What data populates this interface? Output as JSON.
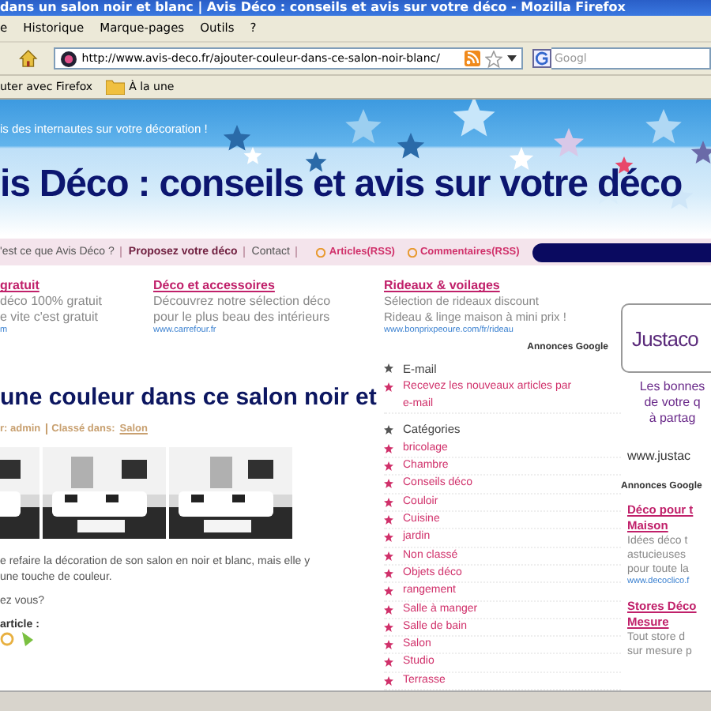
{
  "window": {
    "title": "dans un salon noir et blanc | Avis Déco : conseils et avis sur votre déco - Mozilla Firefox"
  },
  "menu": [
    "e",
    "Historique",
    "Marque-pages",
    "Outils",
    "?"
  ],
  "address": {
    "url": "http://www.avis-deco.fr/ajouter-couleur-dans-ce-salon-noir-blanc/"
  },
  "search": {
    "placeholder": "Googl"
  },
  "bookmarks": [
    {
      "label": "uter avec Firefox",
      "kind": "link"
    },
    {
      "label": "À la une",
      "kind": "folder"
    }
  ],
  "site": {
    "tagline": "is des internautes sur votre décoration !",
    "title": "is Déco : conseils et avis sur votre déco"
  },
  "nav": {
    "links": [
      {
        "label": "'est ce que Avis Déco ?",
        "bold": false
      },
      {
        "label": "Proposez votre déco",
        "bold": true
      },
      {
        "label": "Contact",
        "bold": false
      }
    ],
    "feeds": [
      "Articles(RSS)",
      "Commentaires(RSS)"
    ]
  },
  "ads": [
    {
      "title": "gratuit",
      "lines": [
        "déco 100% gratuit",
        "e vite c'est gratuit"
      ],
      "url": "m"
    },
    {
      "title": "Déco et accessoires",
      "lines": [
        "Découvrez notre sélection déco",
        "pour le plus beau des intérieurs"
      ],
      "url": "www.carrefour.fr"
    },
    {
      "title": "Rideaux & voilages",
      "lines": [
        "Sélection de rideaux discount",
        "Rideau & linge maison à mini prix !"
      ],
      "url": "www.bonprixpeoure.com/fr/rideau"
    }
  ],
  "ads_label": "Annonces Google",
  "post": {
    "title": "une couleur dans ce salon noir et",
    "author": "r: admin",
    "category_label": "Classé dans:",
    "category": "Salon",
    "photos": [
      {
        "kind": "picture"
      },
      {
        "kind": "picture"
      },
      {
        "kind": "picture"
      }
    ],
    "lines": [
      "e refaire la décoration de son salon en noir et blanc, mais elle y",
      "une touche de couleur."
    ],
    "question": "ez vous?",
    "share_label": "article :"
  },
  "sidebar": {
    "email_heading": "E-mail",
    "email_item": "Recevez les nouveaux articles par e-mail",
    "categories_heading": "Catégories",
    "categories": [
      "bricolage",
      "Chambre",
      "Conseils déco",
      "Couloir",
      "Cuisine",
      "jardin",
      "Non classé",
      "Objets déco",
      "rangement",
      "Salle à manger",
      "Salle de bain",
      "Salon",
      "Studio",
      "Terrasse"
    ]
  },
  "right": {
    "brand": "Justaco",
    "promo": [
      "Les bonnes",
      "de votre q",
      "à partag"
    ],
    "site": "www.justac",
    "ads_label": "Annonces Google",
    "ads": [
      {
        "title_lines": [
          "Déco pour t",
          "Maison"
        ],
        "lines": [
          "Idées déco t",
          "astucieuses",
          "pour toute la"
        ],
        "url": "www.decoclico.f"
      },
      {
        "title_lines": [
          "Stores Déco",
          "Mesure"
        ],
        "lines": [
          "Tout store d",
          "sur mesure p"
        ]
      }
    ]
  }
}
